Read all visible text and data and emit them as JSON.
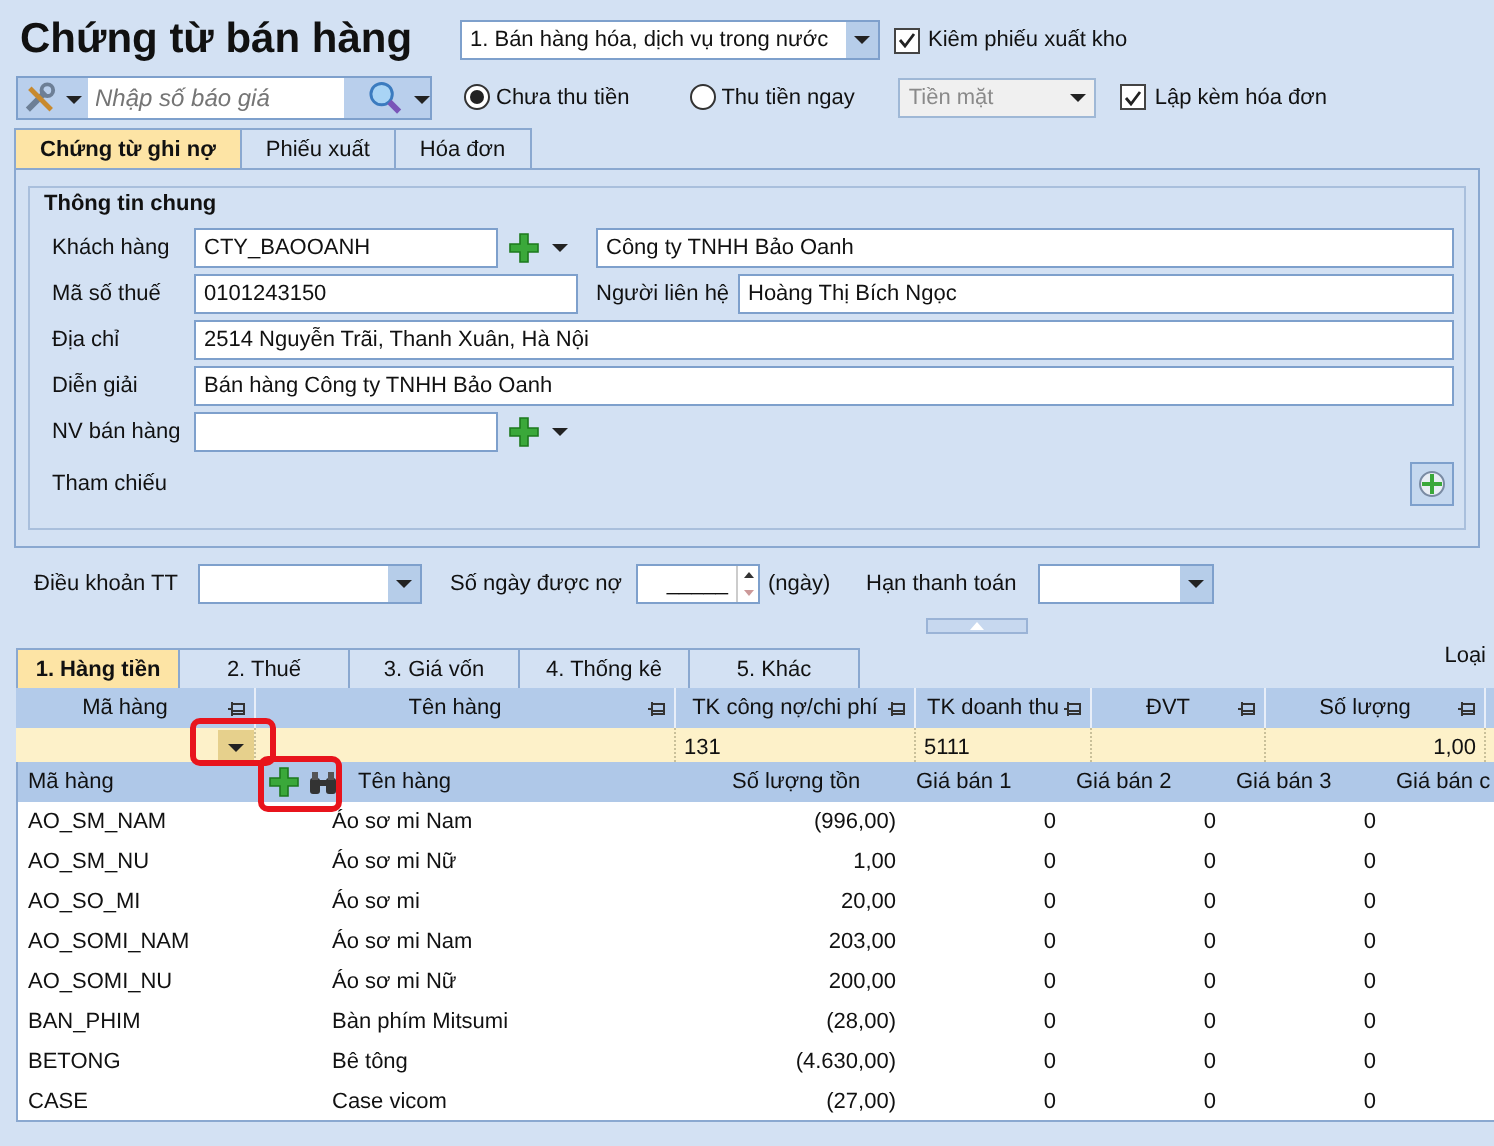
{
  "title": "Chứng từ bán hàng",
  "voucher_type": {
    "value": "1. Bán hàng hóa, dịch vụ trong nước"
  },
  "export_slip": {
    "label": "Kiêm phiếu xuất kho",
    "checked": true
  },
  "quote_search": {
    "placeholder": "Nhập số báo giá"
  },
  "payment": [
    {
      "label": "Chưa thu tiền",
      "selected": true
    },
    {
      "label": "Thu tiền ngay",
      "selected": false
    }
  ],
  "payment_method": {
    "value": "Tiền mặt",
    "disabled": true
  },
  "invoice": {
    "label": "Lập kèm hóa đơn",
    "checked": true
  },
  "tabs": [
    {
      "label": "Chứng từ ghi nợ",
      "selected": true
    },
    {
      "label": "Phiếu xuất",
      "selected": false
    },
    {
      "label": "Hóa đơn",
      "selected": false
    }
  ],
  "general": {
    "title": "Thông tin chung",
    "customer": {
      "label": "Khách hàng",
      "code": "CTY_BAOOANH",
      "name": "Công ty TNHH Bảo Oanh"
    },
    "tax": {
      "label": "Mã số thuế",
      "value": "0101243150",
      "contact_label": "Người liên hệ",
      "contact": "Hoàng Thị Bích Ngọc"
    },
    "address": {
      "label": "Địa chỉ",
      "value": "2514 Nguyễn Trãi, Thanh Xuân, Hà Nội"
    },
    "description": {
      "label": "Diễn giải",
      "value": "Bán hàng Công ty TNHH Bảo Oanh"
    },
    "salesperson": {
      "label": "NV bán hàng"
    },
    "reference": {
      "label": "Tham chiếu"
    }
  },
  "terms": {
    "payment_terms_label": "Điều khoản TT",
    "days_label": "Số ngày được nợ",
    "days_value": "_____",
    "days_unit": "(ngày)",
    "due_label": "Hạn thanh toán"
  },
  "detail_tabs": [
    {
      "label": "1. Hàng tiền",
      "selected": true
    },
    {
      "label": "2. Thuế",
      "selected": false
    },
    {
      "label": "3. Giá vốn",
      "selected": false
    },
    {
      "label": "4. Thống kê",
      "selected": false
    },
    {
      "label": "5. Khác",
      "selected": false
    }
  ],
  "type_label": "Loại",
  "grid": {
    "columns": [
      "Mã hàng",
      "Tên hàng",
      "TK công nợ/chi phí",
      "TK doanh thu",
      "ĐVT",
      "Số lượng"
    ],
    "row": {
      "debit_account": "131",
      "revenue_account": "5111",
      "quantity": "1,00"
    }
  },
  "lookup": {
    "columns": [
      "Mã hàng",
      "Tên hàng",
      "Số lượng tồn",
      "Giá bán 1",
      "Giá bán 2",
      "Giá bán 3",
      "Giá bán c"
    ],
    "rows": [
      {
        "code": "AO_SM_NAM",
        "name": "Áo sơ mi Nam",
        "stock": "(996,00)",
        "price_1": "0",
        "price_2": "0",
        "price_3": "0"
      },
      {
        "code": "AO_SM_NU",
        "name": "Áo sơ mi Nữ",
        "stock": "1,00",
        "price_1": "0",
        "price_2": "0",
        "price_3": "0"
      },
      {
        "code": "AO_SO_MI",
        "name": "Áo sơ mi",
        "stock": "20,00",
        "price_1": "0",
        "price_2": "0",
        "price_3": "0"
      },
      {
        "code": "AO_SOMI_NAM",
        "name": "Áo sơ mi Nam",
        "stock": "203,00",
        "price_1": "0",
        "price_2": "0",
        "price_3": "0"
      },
      {
        "code": "AO_SOMI_NU",
        "name": "Áo sơ mi Nữ",
        "stock": "200,00",
        "price_1": "0",
        "price_2": "0",
        "price_3": "0"
      },
      {
        "code": "BAN_PHIM",
        "name": "Bàn phím Mitsumi",
        "stock": "(28,00)",
        "price_1": "0",
        "price_2": "0",
        "price_3": "0"
      },
      {
        "code": "BETONG",
        "name": "Bê tông",
        "stock": "(4.630,00)",
        "price_1": "0",
        "price_2": "0",
        "price_3": "0"
      },
      {
        "code": "CASE",
        "name": "Case vicom",
        "stock": "(27,00)",
        "price_1": "0",
        "price_2": "0",
        "price_3": "0"
      }
    ]
  }
}
